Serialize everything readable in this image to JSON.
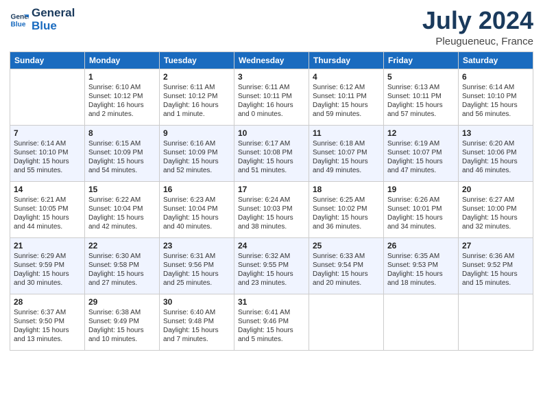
{
  "header": {
    "logo_line1": "General",
    "logo_line2": "Blue",
    "month_title": "July 2024",
    "location": "Pleugueneuc, France"
  },
  "weekdays": [
    "Sunday",
    "Monday",
    "Tuesday",
    "Wednesday",
    "Thursday",
    "Friday",
    "Saturday"
  ],
  "weeks": [
    [
      {
        "day": "",
        "info": ""
      },
      {
        "day": "1",
        "info": "Sunrise: 6:10 AM\nSunset: 10:12 PM\nDaylight: 16 hours\nand 2 minutes."
      },
      {
        "day": "2",
        "info": "Sunrise: 6:11 AM\nSunset: 10:12 PM\nDaylight: 16 hours\nand 1 minute."
      },
      {
        "day": "3",
        "info": "Sunrise: 6:11 AM\nSunset: 10:11 PM\nDaylight: 16 hours\nand 0 minutes."
      },
      {
        "day": "4",
        "info": "Sunrise: 6:12 AM\nSunset: 10:11 PM\nDaylight: 15 hours\nand 59 minutes."
      },
      {
        "day": "5",
        "info": "Sunrise: 6:13 AM\nSunset: 10:11 PM\nDaylight: 15 hours\nand 57 minutes."
      },
      {
        "day": "6",
        "info": "Sunrise: 6:14 AM\nSunset: 10:10 PM\nDaylight: 15 hours\nand 56 minutes."
      }
    ],
    [
      {
        "day": "7",
        "info": "Sunrise: 6:14 AM\nSunset: 10:10 PM\nDaylight: 15 hours\nand 55 minutes."
      },
      {
        "day": "8",
        "info": "Sunrise: 6:15 AM\nSunset: 10:09 PM\nDaylight: 15 hours\nand 54 minutes."
      },
      {
        "day": "9",
        "info": "Sunrise: 6:16 AM\nSunset: 10:09 PM\nDaylight: 15 hours\nand 52 minutes."
      },
      {
        "day": "10",
        "info": "Sunrise: 6:17 AM\nSunset: 10:08 PM\nDaylight: 15 hours\nand 51 minutes."
      },
      {
        "day": "11",
        "info": "Sunrise: 6:18 AM\nSunset: 10:07 PM\nDaylight: 15 hours\nand 49 minutes."
      },
      {
        "day": "12",
        "info": "Sunrise: 6:19 AM\nSunset: 10:07 PM\nDaylight: 15 hours\nand 47 minutes."
      },
      {
        "day": "13",
        "info": "Sunrise: 6:20 AM\nSunset: 10:06 PM\nDaylight: 15 hours\nand 46 minutes."
      }
    ],
    [
      {
        "day": "14",
        "info": "Sunrise: 6:21 AM\nSunset: 10:05 PM\nDaylight: 15 hours\nand 44 minutes."
      },
      {
        "day": "15",
        "info": "Sunrise: 6:22 AM\nSunset: 10:04 PM\nDaylight: 15 hours\nand 42 minutes."
      },
      {
        "day": "16",
        "info": "Sunrise: 6:23 AM\nSunset: 10:04 PM\nDaylight: 15 hours\nand 40 minutes."
      },
      {
        "day": "17",
        "info": "Sunrise: 6:24 AM\nSunset: 10:03 PM\nDaylight: 15 hours\nand 38 minutes."
      },
      {
        "day": "18",
        "info": "Sunrise: 6:25 AM\nSunset: 10:02 PM\nDaylight: 15 hours\nand 36 minutes."
      },
      {
        "day": "19",
        "info": "Sunrise: 6:26 AM\nSunset: 10:01 PM\nDaylight: 15 hours\nand 34 minutes."
      },
      {
        "day": "20",
        "info": "Sunrise: 6:27 AM\nSunset: 10:00 PM\nDaylight: 15 hours\nand 32 minutes."
      }
    ],
    [
      {
        "day": "21",
        "info": "Sunrise: 6:29 AM\nSunset: 9:59 PM\nDaylight: 15 hours\nand 30 minutes."
      },
      {
        "day": "22",
        "info": "Sunrise: 6:30 AM\nSunset: 9:58 PM\nDaylight: 15 hours\nand 27 minutes."
      },
      {
        "day": "23",
        "info": "Sunrise: 6:31 AM\nSunset: 9:56 PM\nDaylight: 15 hours\nand 25 minutes."
      },
      {
        "day": "24",
        "info": "Sunrise: 6:32 AM\nSunset: 9:55 PM\nDaylight: 15 hours\nand 23 minutes."
      },
      {
        "day": "25",
        "info": "Sunrise: 6:33 AM\nSunset: 9:54 PM\nDaylight: 15 hours\nand 20 minutes."
      },
      {
        "day": "26",
        "info": "Sunrise: 6:35 AM\nSunset: 9:53 PM\nDaylight: 15 hours\nand 18 minutes."
      },
      {
        "day": "27",
        "info": "Sunrise: 6:36 AM\nSunset: 9:52 PM\nDaylight: 15 hours\nand 15 minutes."
      }
    ],
    [
      {
        "day": "28",
        "info": "Sunrise: 6:37 AM\nSunset: 9:50 PM\nDaylight: 15 hours\nand 13 minutes."
      },
      {
        "day": "29",
        "info": "Sunrise: 6:38 AM\nSunset: 9:49 PM\nDaylight: 15 hours\nand 10 minutes."
      },
      {
        "day": "30",
        "info": "Sunrise: 6:40 AM\nSunset: 9:48 PM\nDaylight: 15 hours\nand 7 minutes."
      },
      {
        "day": "31",
        "info": "Sunrise: 6:41 AM\nSunset: 9:46 PM\nDaylight: 15 hours\nand 5 minutes."
      },
      {
        "day": "",
        "info": ""
      },
      {
        "day": "",
        "info": ""
      },
      {
        "day": "",
        "info": ""
      }
    ]
  ]
}
